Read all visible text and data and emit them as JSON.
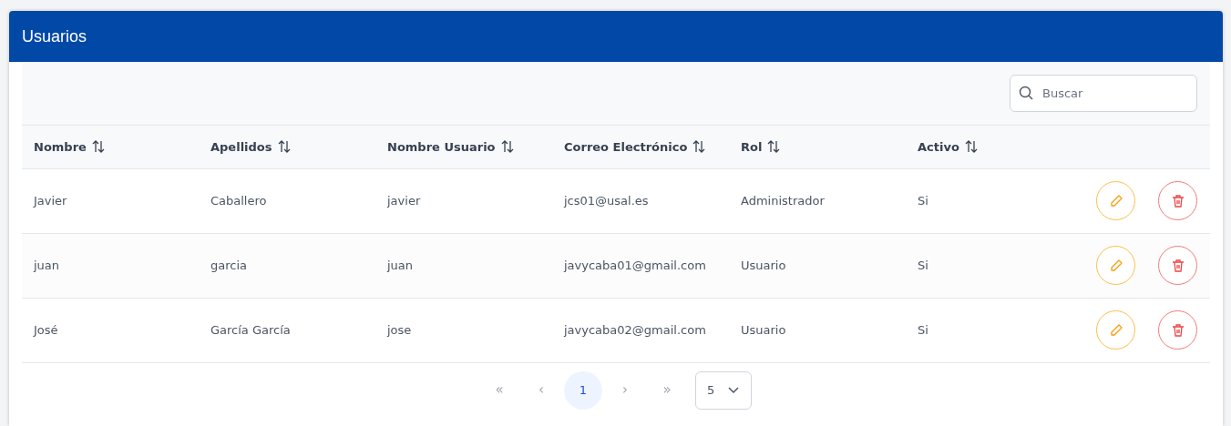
{
  "card": {
    "title": "Usuarios"
  },
  "search": {
    "placeholder": "Buscar"
  },
  "table": {
    "columns": [
      "Nombre",
      "Apellidos",
      "Nombre Usuario",
      "Correo Electrónico",
      "Rol",
      "Activo"
    ],
    "rows": [
      [
        "Javier",
        "Caballero",
        "javier",
        "jcs01@usal.es",
        "Administrador",
        "Si"
      ],
      [
        "juan",
        "garcia",
        "juan",
        "javycaba01@gmail.com",
        "Usuario",
        "Si"
      ],
      [
        "José",
        "García García",
        "jose",
        "javycaba02@gmail.com",
        "Usuario",
        "Si"
      ]
    ]
  },
  "pagination": {
    "items": [
      {
        "kind": "first",
        "label": "«",
        "disabled": true,
        "selected": false
      },
      {
        "kind": "prev",
        "label": "‹",
        "disabled": true,
        "selected": false
      },
      {
        "kind": "page",
        "label": "1",
        "disabled": false,
        "selected": true
      },
      {
        "kind": "next",
        "label": "›",
        "disabled": true,
        "selected": false
      },
      {
        "kind": "last",
        "label": "»",
        "disabled": true,
        "selected": false
      }
    ],
    "page_size": "5"
  }
}
